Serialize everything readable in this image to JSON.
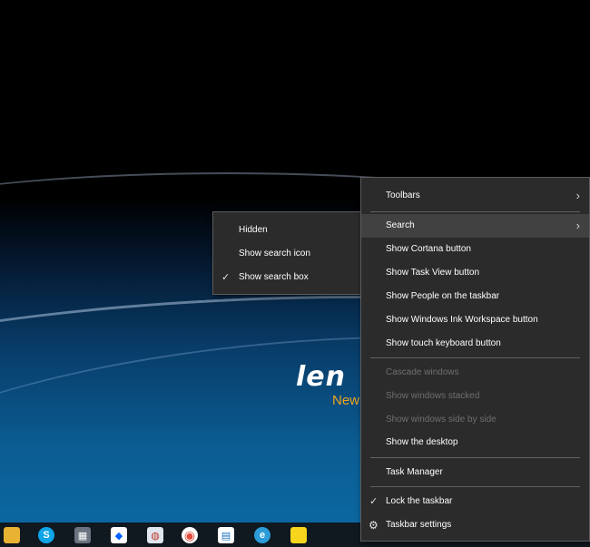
{
  "wallpaper": {
    "logo_text": "len",
    "logo_sub": "New"
  },
  "taskbar": {
    "icons": [
      {
        "name": "file-explorer-icon",
        "glyph": "",
        "color": "#e8b233"
      },
      {
        "name": "skype-icon",
        "glyph": "S",
        "color": "#0ea5e9"
      },
      {
        "name": "calculator-icon",
        "glyph": "▦",
        "color": "#6b7280"
      },
      {
        "name": "dropbox-icon",
        "glyph": "◆",
        "color": "#ffffff"
      },
      {
        "name": "app-icon",
        "glyph": "◍",
        "color": "#c0392b"
      },
      {
        "name": "chrome-icon",
        "glyph": "◉",
        "color": "#e24a3b"
      },
      {
        "name": "store-icon",
        "glyph": "▤",
        "color": "#ffffff"
      },
      {
        "name": "edge-icon",
        "glyph": "e",
        "color": "#2b9cd8"
      },
      {
        "name": "sticky-notes-icon",
        "glyph": "",
        "color": "#f7d51d"
      }
    ]
  },
  "context_menu": {
    "toolbars": "Toolbars",
    "search": "Search",
    "show_cortana": "Show Cortana button",
    "show_task_view": "Show Task View button",
    "show_people": "Show People on the taskbar",
    "show_ink": "Show Windows Ink Workspace button",
    "show_touch_keyboard": "Show touch keyboard button",
    "cascade": "Cascade windows",
    "stacked": "Show windows stacked",
    "side_by_side": "Show windows side by side",
    "show_desktop": "Show the desktop",
    "task_manager": "Task Manager",
    "lock_taskbar": "Lock the taskbar",
    "taskbar_settings": "Taskbar settings",
    "chevron": "›",
    "check": "✓",
    "gear": "⚙"
  },
  "search_submenu": {
    "hidden": "Hidden",
    "show_icon": "Show search icon",
    "show_box": "Show search box",
    "check": "✓"
  }
}
